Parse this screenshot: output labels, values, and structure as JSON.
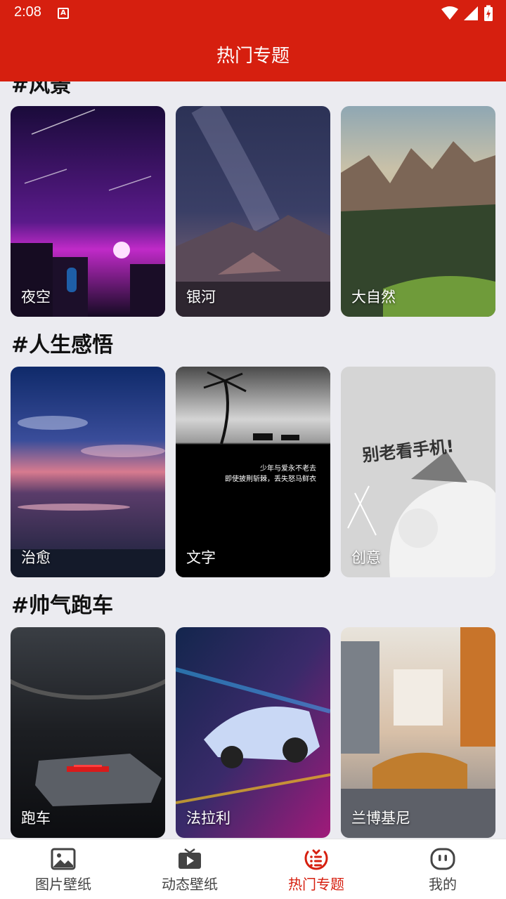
{
  "status": {
    "time": "2:08",
    "notif_icon": "A"
  },
  "appbar": {
    "title": "热门专题"
  },
  "sections": [
    {
      "title": "#风景",
      "items": [
        {
          "label": "夜空"
        },
        {
          "label": "银河"
        },
        {
          "label": "大自然"
        }
      ]
    },
    {
      "title": "#人生感悟",
      "items": [
        {
          "label": "治愈"
        },
        {
          "label": "文字",
          "quote1": "少年与爱永不老去",
          "quote2": "即使披荆斩棘，丢失怒马鲜衣"
        },
        {
          "label": "创意",
          "art_text": "别老看手机!"
        }
      ]
    },
    {
      "title": "#帅气跑车",
      "items": [
        {
          "label": "跑车"
        },
        {
          "label": "法拉利"
        },
        {
          "label": "兰博基尼"
        }
      ]
    }
  ],
  "tabs": [
    {
      "label": "图片壁纸",
      "icon": "image-icon"
    },
    {
      "label": "动态壁纸",
      "icon": "video-icon"
    },
    {
      "label": "热门专题",
      "icon": "hot-topics-icon",
      "active": true
    },
    {
      "label": "我的",
      "icon": "profile-icon"
    }
  ],
  "colors": {
    "accent": "#d61f0f",
    "background": "#ebebf0"
  }
}
